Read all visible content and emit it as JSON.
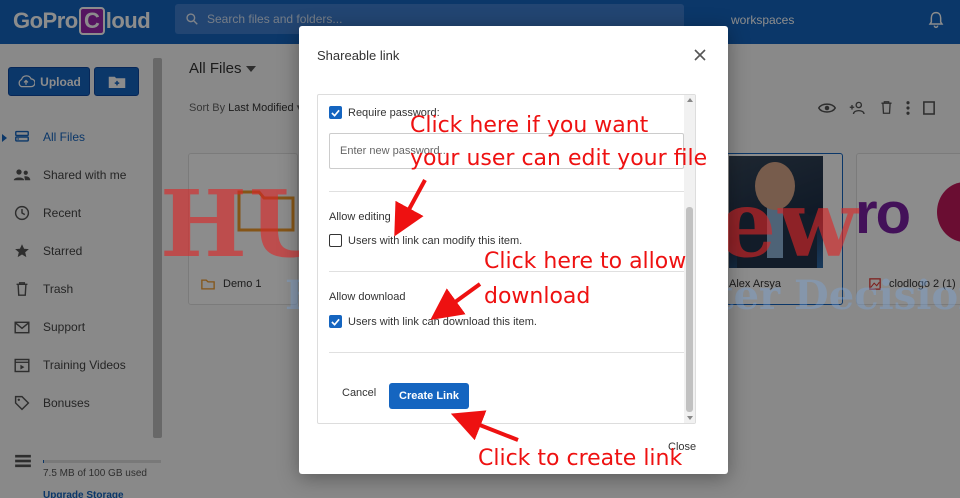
{
  "app": {
    "logo_pre": "GoPro",
    "logo_c": "C",
    "logo_post": "loud",
    "search_placeholder": "Search files and folders...",
    "workspaces": "workspaces"
  },
  "sidebar": {
    "upload_label": "Upload",
    "items": [
      {
        "label": "All Files",
        "icon": "hdd-icon"
      },
      {
        "label": "Shared with me",
        "icon": "people-icon"
      },
      {
        "label": "Recent",
        "icon": "clock-icon"
      },
      {
        "label": "Starred",
        "icon": "star-icon"
      },
      {
        "label": "Trash",
        "icon": "trash-icon"
      },
      {
        "label": "Support",
        "icon": "mail-icon"
      },
      {
        "label": "Training Videos",
        "icon": "video-icon"
      },
      {
        "label": "Bonuses",
        "icon": "tag-icon"
      }
    ],
    "storage_text": "7.5 MB of 100 GB used",
    "storage_fraction": 0.0001,
    "upgrade": "Upgrade Storage"
  },
  "main": {
    "title": "All Files",
    "sort_prefix": "Sort By",
    "sort_value": "Last Modified",
    "cards": [
      {
        "label": "Demo 1",
        "type": "folder"
      },
      {
        "label": "Alex Arsya",
        "type": "image"
      },
      {
        "label": "clodlogo 2 (1)",
        "type": "image"
      }
    ]
  },
  "dialog": {
    "title": "Shareable link",
    "require_password": "Require password:",
    "password_placeholder": "Enter new password...",
    "allow_editing": "Allow editing",
    "editing_option": "Users with link can modify this item.",
    "allow_download": "Allow download",
    "download_option": "Users with link can download this item.",
    "cancel": "Cancel",
    "create": "Create Link",
    "close": "Close"
  },
  "annotations": {
    "edit_line1": "Click here if you want",
    "edit_line2": "your user can edit your file",
    "download_line1": "Click here to allow",
    "download_line2": "download",
    "create": "Click to create link"
  },
  "watermark": {
    "line1": "HUDAReview",
    "line2": "Help You Make Better Decisions"
  },
  "colors": {
    "brand": "#1565c0",
    "annotation": "#ee1111",
    "logo_c": "#9c27b0"
  }
}
